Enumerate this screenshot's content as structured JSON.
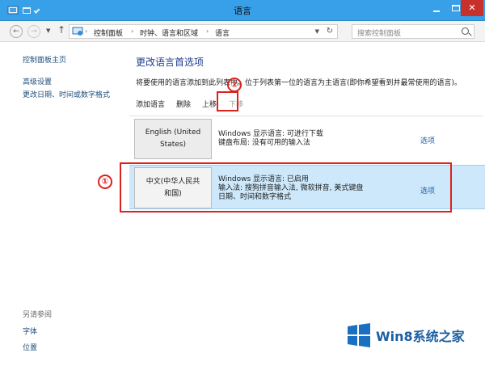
{
  "window": {
    "title": "语言",
    "accent": "#37a0e8",
    "close_color": "#c7302b"
  },
  "nav": {
    "breadcrumb": [
      "控制面板",
      "时钟、语言和区域",
      "语言"
    ],
    "separator": "›",
    "search_placeholder": "搜索控制面板"
  },
  "sidebar": {
    "home": "控制面板主页",
    "links": [
      "高级设置",
      "更改日期、时间或数字格式"
    ],
    "see_also_title": "另请参阅",
    "see_also": [
      "字体",
      "位置"
    ]
  },
  "main": {
    "heading": "更改语言首选项",
    "description": "将要使用的语言添加到此列表中。位于列表第一位的语言为主语言(即你希望看到并最常使用的语言)。",
    "toolbar": {
      "add": "添加语言",
      "remove": "删除",
      "move_up": "上移",
      "move_down": "下移"
    },
    "languages": [
      {
        "name_line1": "English (United",
        "name_line2": "States)",
        "info": [
          "Windows 显示语言: 可进行下载",
          "键盘布局: 没有可用的输入法"
        ],
        "options": "选项"
      },
      {
        "name_line1": "中文(中华人民共",
        "name_line2": "和国)",
        "info": [
          "Windows 显示语言: 已启用",
          "输入法: 搜狗拼音输入法, 微软拼音, 美式键盘",
          "日期、时间和数字格式"
        ],
        "options": "选项",
        "selected": true
      }
    ]
  },
  "annotations": {
    "badge1": "①",
    "badge2": "②",
    "color": "#d8231e"
  },
  "watermark": {
    "text": "Win8系统之家"
  }
}
